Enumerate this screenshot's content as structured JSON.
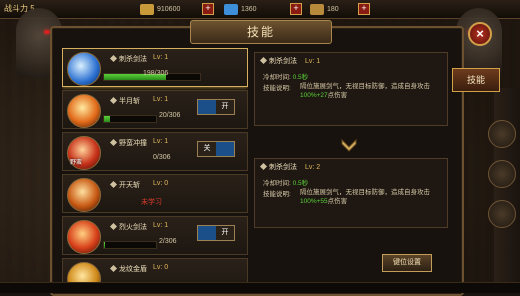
{
  "topbar": {
    "level": "战斗力 5",
    "gold": "910600",
    "diamond": "1360",
    "coins": "180"
  },
  "window": {
    "title": "技能",
    "side_tab": "技能",
    "keybind_button": "键位设置",
    "close": "×"
  },
  "skills": [
    {
      "name": "刺杀剑法",
      "level": "Lv: 1",
      "progress": "198/306",
      "pct": 0.65,
      "selected": true
    },
    {
      "name": "半月斩",
      "level": "Lv: 1",
      "progress": "20/306",
      "pct": 0.07,
      "toggle": "开"
    },
    {
      "name": "野蛮冲撞",
      "level": "Lv: 1",
      "progress": "0/306",
      "pct": 0,
      "toggle": "关",
      "icon_tag": "野蛮"
    },
    {
      "name": "开天斩",
      "level": "Lv: 0",
      "locked": "未学习"
    },
    {
      "name": "烈火剑法",
      "level": "Lv: 1",
      "progress": "2/306",
      "pct": 0.01,
      "toggle": "开"
    },
    {
      "name": "龙纹金盾",
      "level": "Lv: 0"
    }
  ],
  "detail_current": {
    "name": "刺杀剑法",
    "level": "Lv: 1",
    "cooldown_label": "冷却时间:",
    "cooldown": "0.5秒",
    "desc_label": "技能说明:",
    "desc": "隔位施展剑气，无视目标防御，造成自身攻击",
    "desc_g": "100%+27",
    "desc_tail": "点伤害"
  },
  "detail_next": {
    "name": "刺杀剑法",
    "level": "Lv: 2",
    "cooldown_label": "冷却时间:",
    "cooldown": "0.5秒",
    "desc_label": "技能说明:",
    "desc": "隔位施展剑气，无视目标防御，造成自身攻击",
    "desc_g": "100%+55",
    "desc_tail": "点伤害"
  }
}
